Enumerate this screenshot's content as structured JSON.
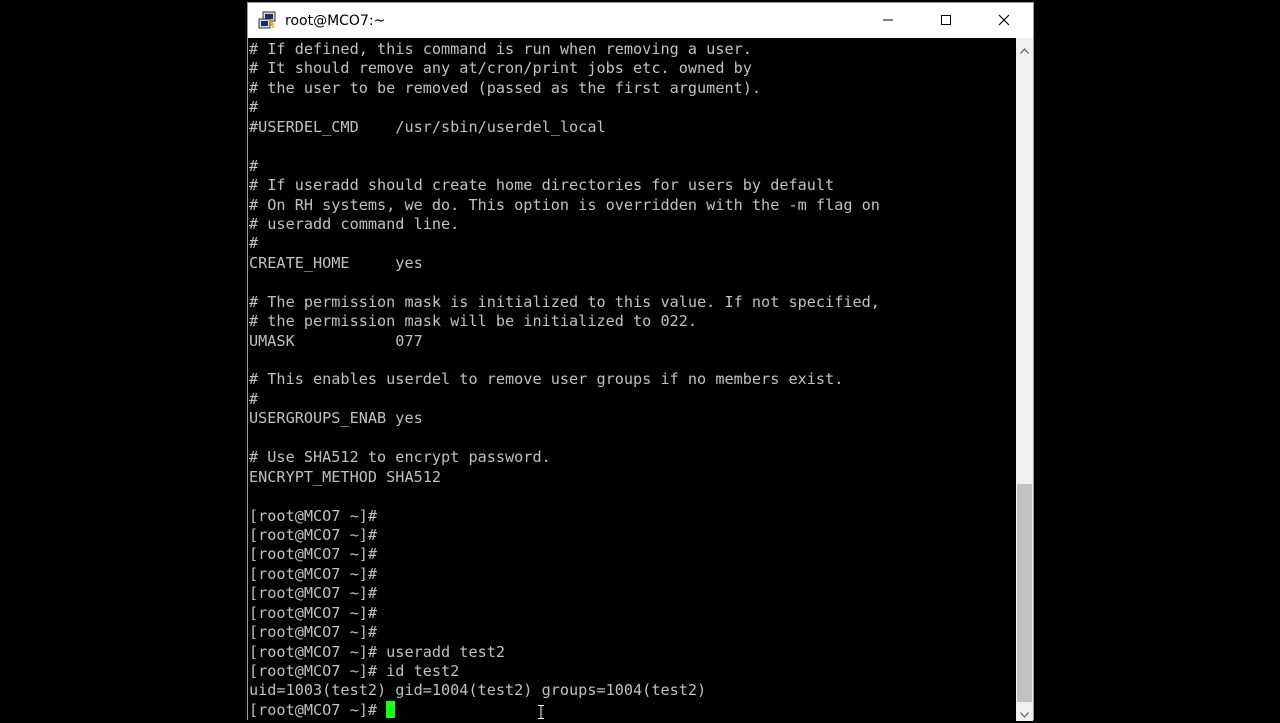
{
  "window": {
    "title": "root@MCO7:~",
    "icon": "putty-icon",
    "controls": {
      "minimize_icon": "minimize-icon",
      "maximize_icon": "maximize-icon",
      "close_icon": "close-icon"
    }
  },
  "terminal": {
    "foreground": "#c0c0c0",
    "background": "#000000",
    "cursor_color": "#1aff1a",
    "lines": [
      "# If defined, this command is run when removing a user.",
      "# It should remove any at/cron/print jobs etc. owned by",
      "# the user to be removed (passed as the first argument).",
      "#",
      "#USERDEL_CMD    /usr/sbin/userdel_local",
      "",
      "#",
      "# If useradd should create home directories for users by default",
      "# On RH systems, we do. This option is overridden with the -m flag on",
      "# useradd command line.",
      "#",
      "CREATE_HOME     yes",
      "",
      "# The permission mask is initialized to this value. If not specified,",
      "# the permission mask will be initialized to 022.",
      "UMASK           077",
      "",
      "# This enables userdel to remove user groups if no members exist.",
      "#",
      "USERGROUPS_ENAB yes",
      "",
      "# Use SHA512 to encrypt password.",
      "ENCRYPT_METHOD SHA512",
      "",
      "[root@MCO7 ~]#",
      "[root@MCO7 ~]#",
      "[root@MCO7 ~]#",
      "[root@MCO7 ~]#",
      "[root@MCO7 ~]#",
      "[root@MCO7 ~]#",
      "[root@MCO7 ~]#",
      "[root@MCO7 ~]# useradd test2",
      "[root@MCO7 ~]# id test2",
      "uid=1003(test2) gid=1004(test2) groups=1004(test2)"
    ],
    "prompt": "[root@MCO7 ~]# "
  }
}
